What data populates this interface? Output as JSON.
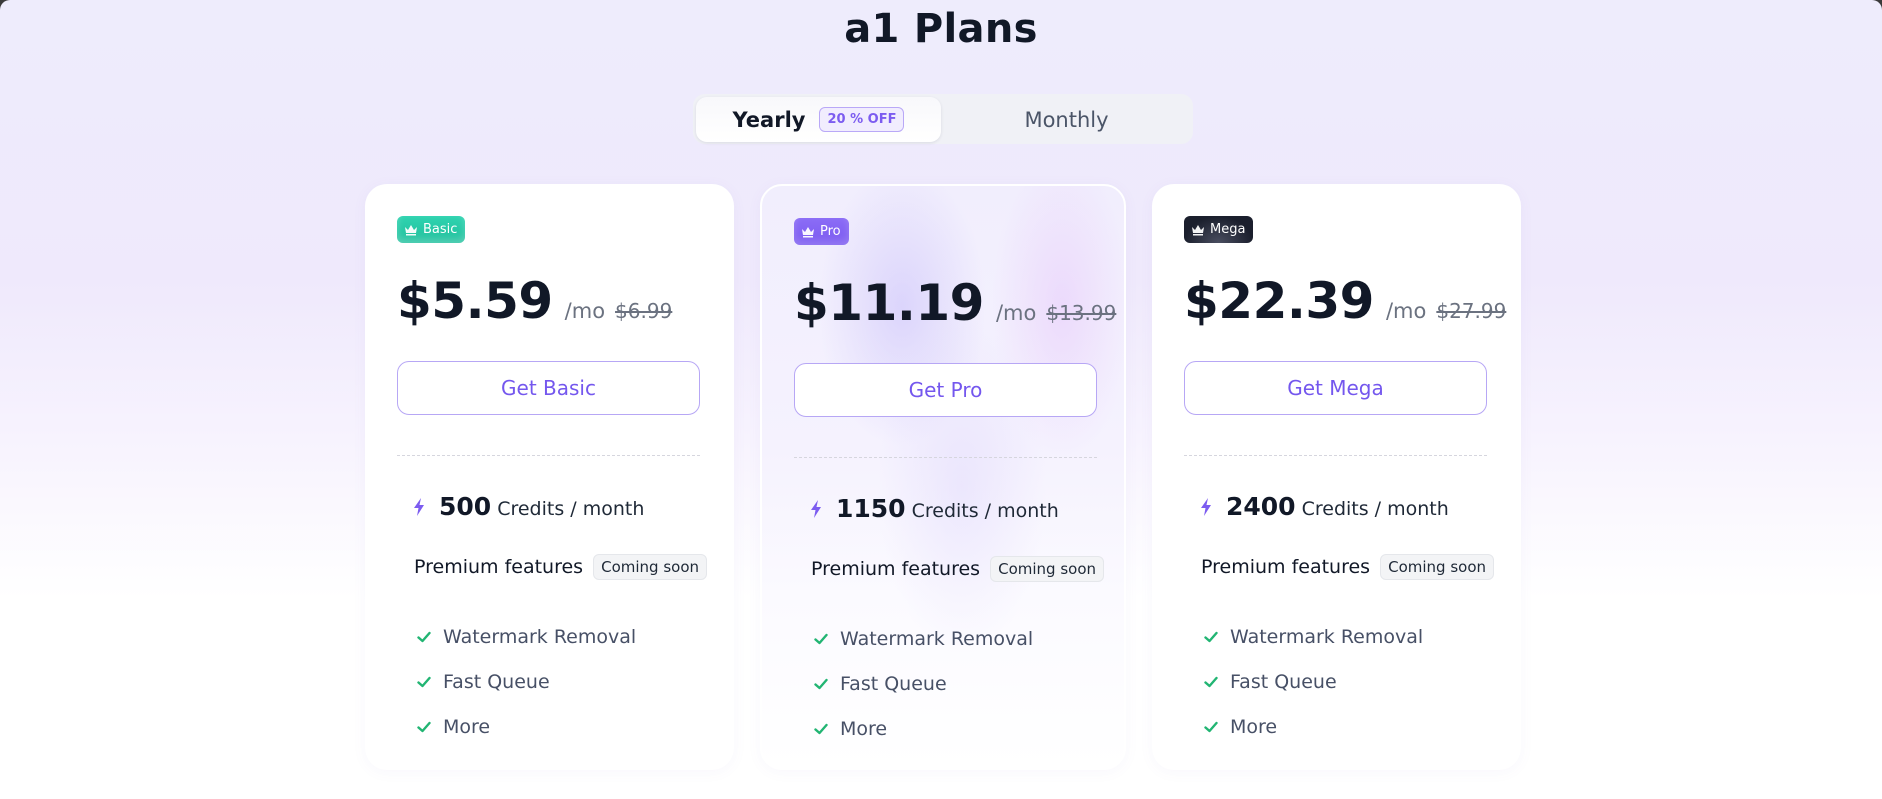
{
  "page": {
    "title": "a1 Plans"
  },
  "billing_toggle": {
    "options": [
      {
        "label": "Yearly",
        "badge": "20 % OFF",
        "active": true
      },
      {
        "label": "Monthly",
        "active": false
      }
    ]
  },
  "colors": {
    "accent": "#7457ee",
    "check": "#22b573",
    "basic_badge": "#1fc8a3",
    "pro_badge": "#7b5af0",
    "mega_badge": "#1b1f2d"
  },
  "plans": [
    {
      "badge": "Basic",
      "badge_icon": "crown-icon",
      "price": "$5.59",
      "period": "/mo",
      "original_price": "$6.99",
      "cta": "Get Basic",
      "credits": "500",
      "credits_unit": "Credits / month",
      "premium_label": "Premium features",
      "premium_status": "Coming soon",
      "features": [
        "Watermark Removal",
        "Fast Queue",
        "More"
      ]
    },
    {
      "badge": "Pro",
      "badge_icon": "crown-icon",
      "price": "$11.19",
      "period": "/mo",
      "original_price": "$13.99",
      "cta": "Get Pro",
      "credits": "1150",
      "credits_unit": "Credits / month",
      "premium_label": "Premium features",
      "premium_status": "Coming soon",
      "features": [
        "Watermark Removal",
        "Fast Queue",
        "More"
      ]
    },
    {
      "badge": "Mega",
      "badge_icon": "crown-icon",
      "price": "$22.39",
      "period": "/mo",
      "original_price": "$27.99",
      "cta": "Get Mega",
      "credits": "2400",
      "credits_unit": "Credits / month",
      "premium_label": "Premium features",
      "premium_status": "Coming soon",
      "features": [
        "Watermark Removal",
        "Fast Queue",
        "More"
      ]
    }
  ]
}
